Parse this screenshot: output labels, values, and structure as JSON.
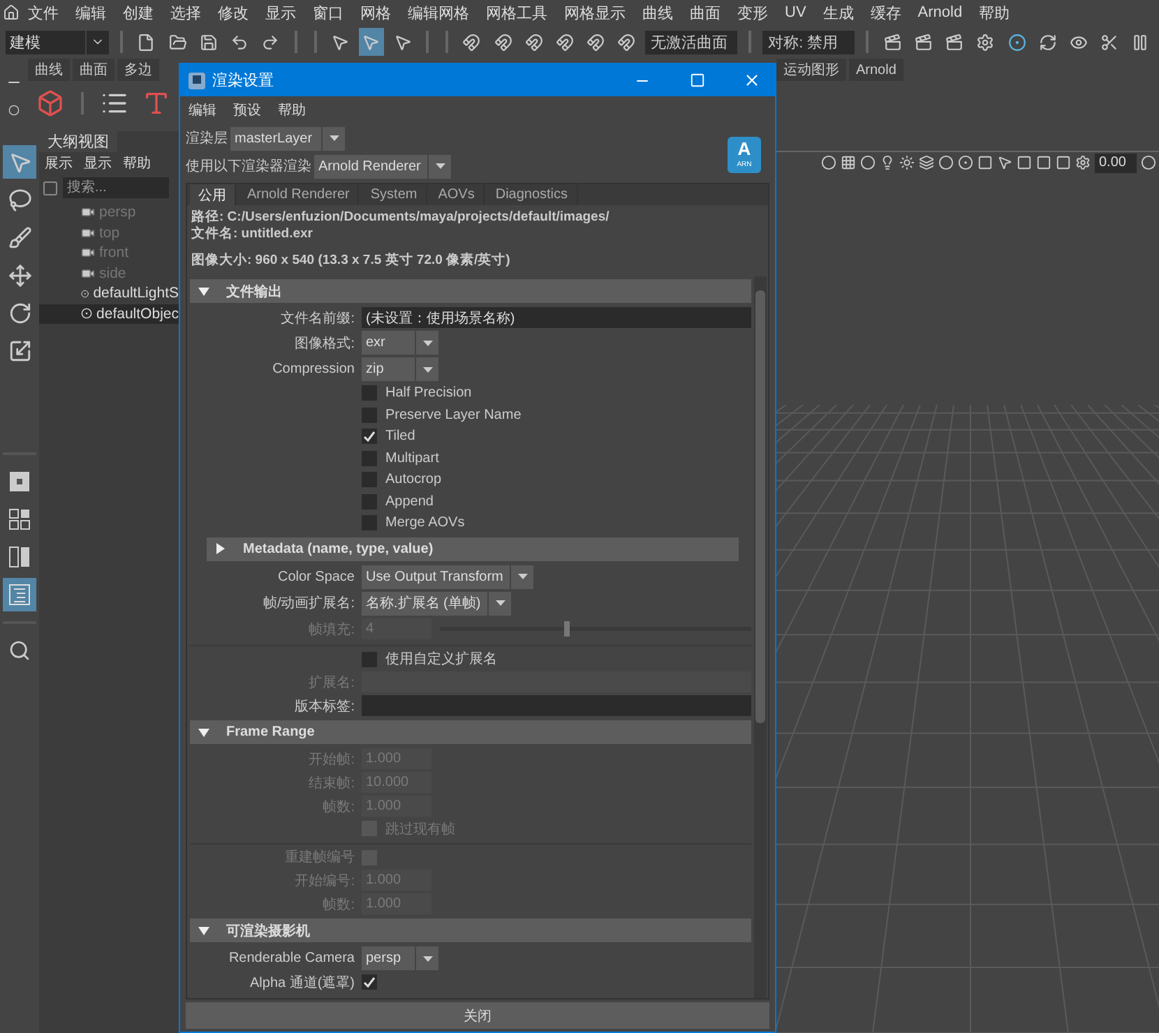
{
  "menu_bar": {
    "items": [
      "文件",
      "编辑",
      "创建",
      "选择",
      "修改",
      "显示",
      "窗口",
      "网格",
      "编辑网格",
      "网格工具",
      "网格显示",
      "曲线",
      "曲面",
      "变形",
      "UV",
      "生成",
      "缓存",
      "Arnold",
      "帮助"
    ]
  },
  "status_line": {
    "workspace": "建模",
    "selection_modes": [
      {
        "selected": false
      },
      {
        "selected": true
      },
      {
        "selected": false
      }
    ],
    "live_surface": "无激活曲面",
    "symmetry": "对称: 禁用"
  },
  "shelf": {
    "left_tabs": [
      {
        "label": "曲线",
        "selected": false
      },
      {
        "label": "曲面",
        "selected": false
      },
      {
        "label": "多边",
        "selected": false
      }
    ],
    "right_tabs": [
      {
        "label": "运动图形",
        "selected": false
      },
      {
        "label": "Arnold",
        "selected": false
      }
    ]
  },
  "toolbox": {
    "tools": [
      {
        "kind": "select",
        "selected": true
      },
      {
        "kind": "lasso",
        "selected": false
      },
      {
        "kind": "paint",
        "selected": false
      },
      {
        "kind": "move",
        "selected": false
      },
      {
        "kind": "rotate",
        "selected": false
      },
      {
        "kind": "scale",
        "selected": false
      }
    ],
    "layouts": [
      {
        "kind": "single",
        "selected": false
      },
      {
        "kind": "four",
        "selected": false
      },
      {
        "kind": "two",
        "selected": false
      },
      {
        "kind": "outliner",
        "selected": true
      }
    ]
  },
  "outliner": {
    "title": "大纲视图",
    "menu": [
      "展示",
      "显示",
      "帮助"
    ],
    "search_placeholder": "搜索...",
    "items": [
      {
        "label": "persp",
        "kind": "camera",
        "dimmed": true,
        "selected": false
      },
      {
        "label": "top",
        "kind": "camera",
        "dimmed": true,
        "selected": false
      },
      {
        "label": "front",
        "kind": "camera",
        "dimmed": true,
        "selected": false
      },
      {
        "label": "side",
        "kind": "camera",
        "dimmed": true,
        "selected": false
      },
      {
        "label": "defaultLightS",
        "kind": "set",
        "dimmed": false,
        "selected": false
      },
      {
        "label": "defaultObjec",
        "kind": "set",
        "dimmed": false,
        "selected": true
      }
    ]
  },
  "viewport": {
    "exposure": "0.00"
  },
  "dialog": {
    "title": "渲染设置",
    "menu": [
      "编辑",
      "预设",
      "帮助"
    ],
    "render_layer": {
      "label": "渲染层",
      "value": "masterLayer"
    },
    "renderer": {
      "label": "使用以下渲染器渲染",
      "value": "Arnold Renderer"
    },
    "logo": {
      "letter": "A",
      "caption": "ARN"
    },
    "tabs": [
      {
        "label": "公用",
        "selected": true
      },
      {
        "label": "Arnold Renderer",
        "selected": false
      },
      {
        "label": "System",
        "selected": false
      },
      {
        "label": "AOVs",
        "selected": false
      },
      {
        "label": "Diagnostics",
        "selected": false
      }
    ],
    "info": {
      "path": "路径: C:/Users/enfuzion/Documents/maya/projects/default/images/",
      "file": "文件名: untitled.exr",
      "size": "图像大小: 960 x 540 (13.3 x 7.5 英寸 72.0 像素/英寸)"
    },
    "sections": [
      {
        "title": "文件输出",
        "expanded": true,
        "rows": [
          {
            "kind": "field",
            "label": "文件名前缀:",
            "value": "(未设置：使用场景名称)",
            "disabled": false
          },
          {
            "kind": "dropdown",
            "label": "图像格式:",
            "value": "exr"
          },
          {
            "kind": "dropdown",
            "label": "Compression",
            "value": "zip"
          },
          {
            "kind": "checkbox",
            "label": "Half Precision",
            "checked": false,
            "disabled": false
          },
          {
            "kind": "checkbox",
            "label": "Preserve Layer Name",
            "checked": false,
            "disabled": false
          },
          {
            "kind": "checkbox",
            "label": "Tiled",
            "checked": true,
            "disabled": false
          },
          {
            "kind": "checkbox",
            "label": "Multipart",
            "checked": false,
            "disabled": false
          },
          {
            "kind": "checkbox",
            "label": "Autocrop",
            "checked": false,
            "disabled": false
          },
          {
            "kind": "checkbox",
            "label": "Append",
            "checked": false,
            "disabled": false
          },
          {
            "kind": "checkbox",
            "label": "Merge AOVs",
            "checked": false,
            "disabled": false
          },
          {
            "kind": "subsection",
            "label": "Metadata (name, type, value)",
            "expanded": false
          },
          {
            "kind": "dropdown",
            "label": "Color Space",
            "value": "Use Output Transform"
          },
          {
            "kind": "dropdown",
            "label": "帧/动画扩展名:",
            "value": "名称.扩展名 (单帧)"
          },
          {
            "kind": "slider",
            "label": "帧填充:",
            "value": "4",
            "level": 0.41,
            "disabled": true
          },
          {
            "kind": "divider"
          },
          {
            "kind": "checkbox",
            "label": "使用自定义扩展名",
            "checked": false,
            "disabled": false
          },
          {
            "kind": "field",
            "label": "扩展名:",
            "disabled": true
          },
          {
            "kind": "field",
            "label": "版本标签:",
            "disabled": false
          }
        ]
      },
      {
        "title": "Frame Range",
        "expanded": true,
        "rows": [
          {
            "kind": "number_field",
            "label": "开始帧:",
            "value": "1.000",
            "disabled": true
          },
          {
            "kind": "number_field",
            "label": "结束帧:",
            "value": "10.000",
            "disabled": true
          },
          {
            "kind": "number_field",
            "label": "帧数:",
            "value": "1.000",
            "disabled": true
          },
          {
            "kind": "checkbox",
            "label": "跳过现有帧",
            "checked": false,
            "disabled": true
          },
          {
            "kind": "divider"
          },
          {
            "kind": "label_checkbox",
            "label": "重建帧编号",
            "checked": false,
            "disabled": true
          },
          {
            "kind": "number_field",
            "label": "开始编号:",
            "value": "1.000",
            "disabled": true
          },
          {
            "kind": "number_field",
            "label": "帧数:",
            "value": "1.000",
            "disabled": true
          }
        ]
      },
      {
        "title": "可渲染摄影机",
        "expanded": true,
        "rows": [
          {
            "kind": "dropdown",
            "label": "Renderable Camera",
            "value": "persp"
          },
          {
            "kind": "label_checkbox",
            "label": "Alpha 通道(遮罩)",
            "checked": true,
            "disabled": false
          }
        ]
      }
    ],
    "close_button": "关闭"
  }
}
